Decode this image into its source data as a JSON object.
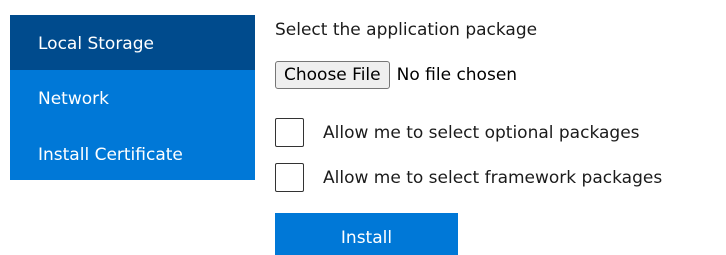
{
  "sidebar": {
    "items": [
      {
        "label": "Local Storage",
        "active": true
      },
      {
        "label": "Network",
        "active": false
      },
      {
        "label": "Install Certificate",
        "active": false
      }
    ]
  },
  "main": {
    "heading": "Select the application package",
    "file_input": {
      "button_label": "Choose File",
      "status": "No file chosen"
    },
    "options": [
      {
        "label": "Allow me to select optional packages",
        "checked": false
      },
      {
        "label": "Allow me to select framework packages",
        "checked": false
      }
    ],
    "install_label": "Install"
  },
  "colors": {
    "accent": "#0078d7",
    "accent_active": "#004b8d"
  }
}
